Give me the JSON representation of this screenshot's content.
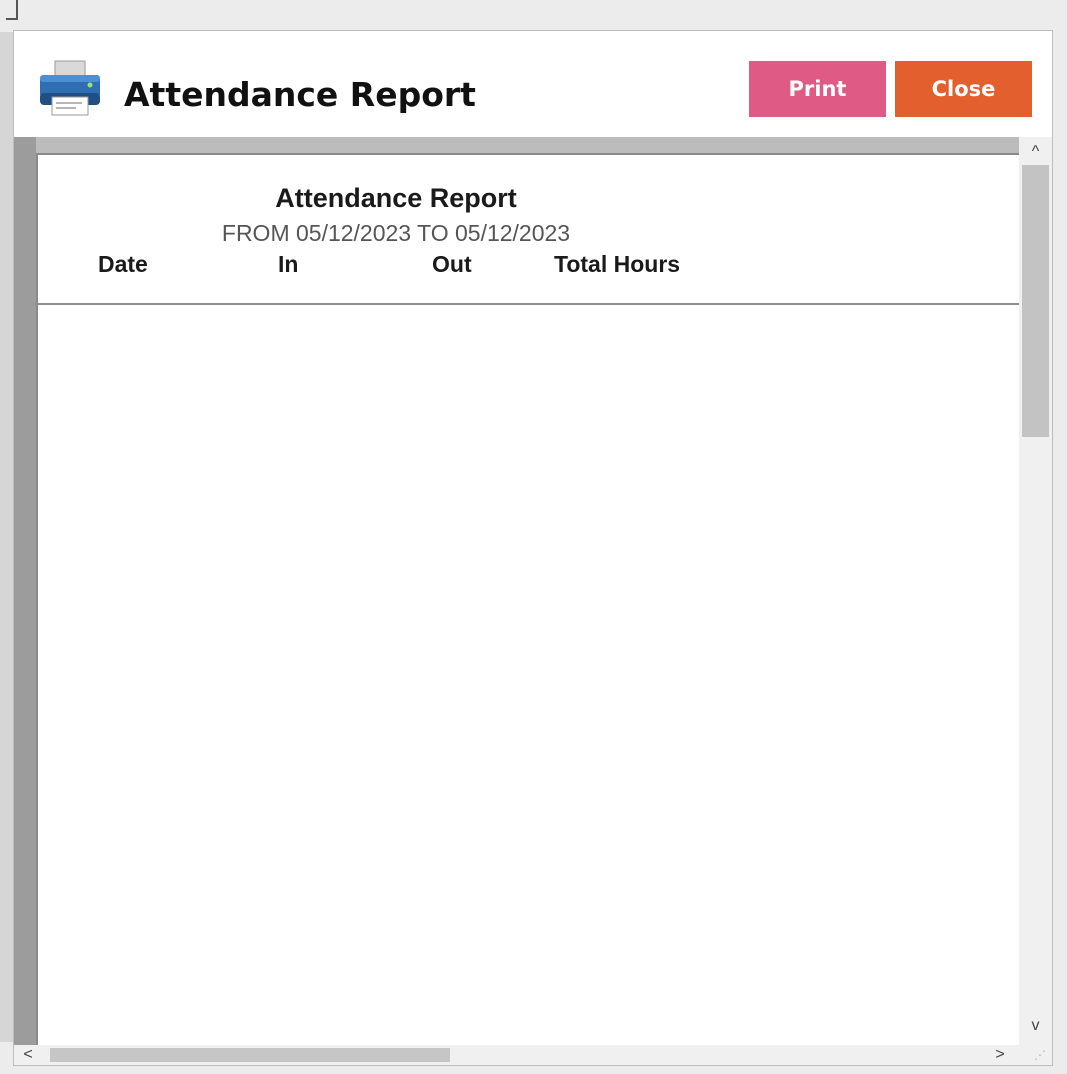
{
  "dialog": {
    "title": "Attendance Report",
    "icon": "printer-icon",
    "buttons": {
      "print_label": "Print",
      "close_label": "Close"
    }
  },
  "report": {
    "title": "Attendance Report",
    "date_range": "FROM 05/12/2023 TO 05/12/2023",
    "columns": [
      "Date",
      "In",
      "Out",
      "Total Hours"
    ],
    "rows": []
  },
  "scrollbars": {
    "up_arrow": "^",
    "down_arrow": "v",
    "left_arrow": "<",
    "right_arrow": ">"
  },
  "colors": {
    "print_button": "#df5b85",
    "close_button": "#e35f2e"
  }
}
